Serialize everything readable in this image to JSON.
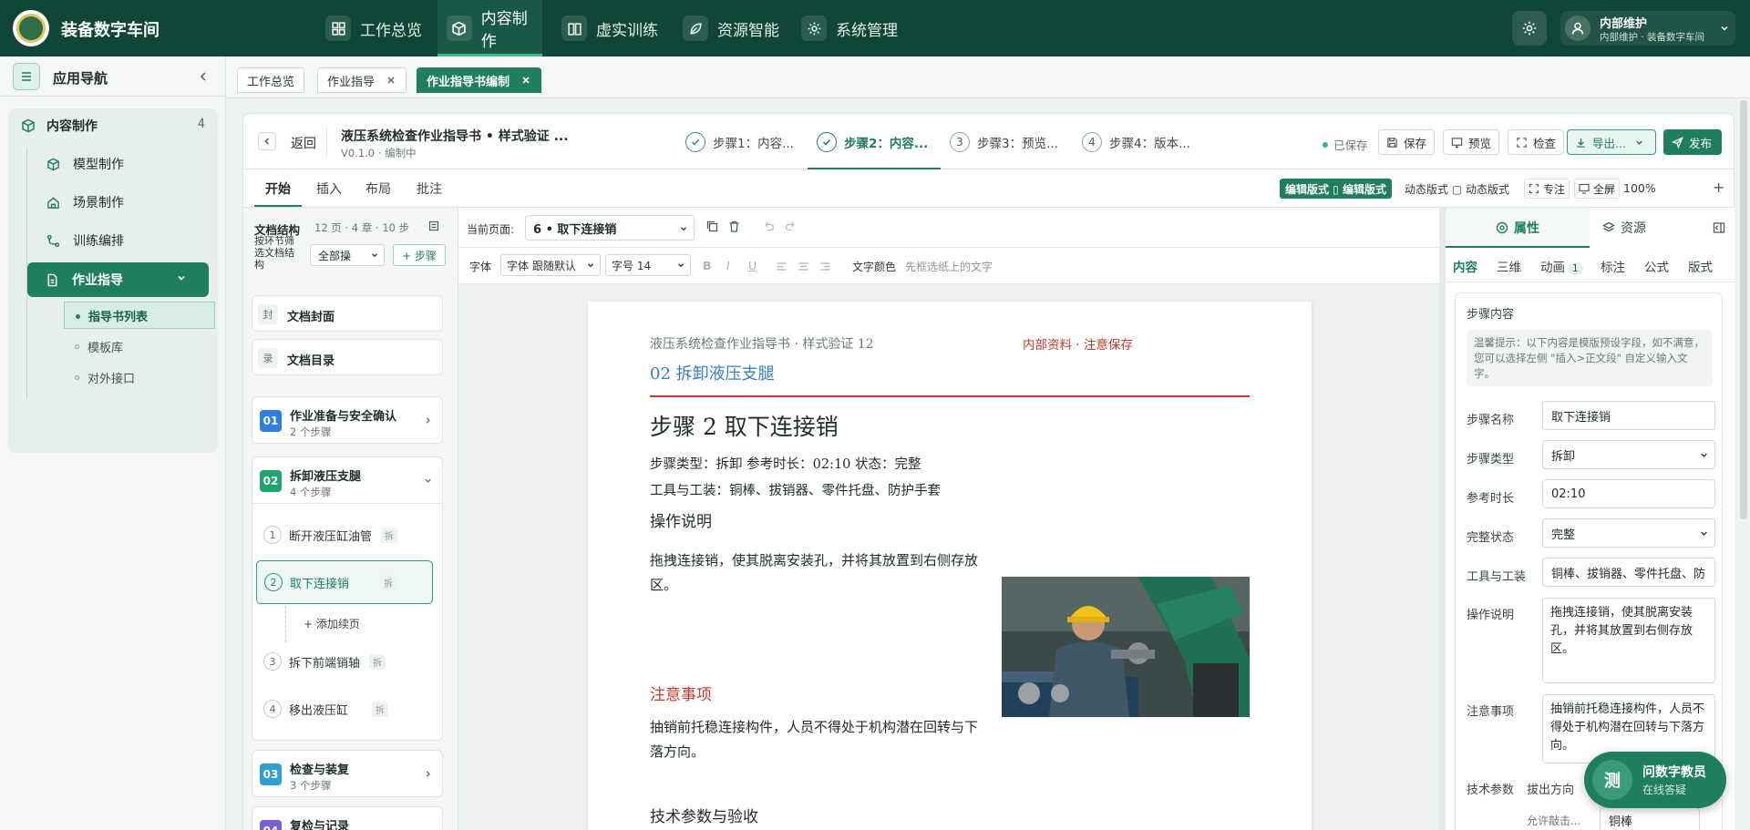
{
  "app": {
    "title": "装备数字车间"
  },
  "topnav": [
    {
      "label": "工作总览",
      "icon": "dashboard-icon",
      "active": false
    },
    {
      "label": "内容制作",
      "icon": "cube-icon",
      "active": true
    },
    {
      "label": "虚实训练",
      "icon": "book-icon",
      "active": false
    },
    {
      "label": "资源智能",
      "icon": "leaf-icon",
      "active": false
    },
    {
      "label": "系统管理",
      "icon": "gear-icon",
      "active": false
    }
  ],
  "user": {
    "name": "内部维护",
    "role": "内部维护 · 装备数字车间"
  },
  "sidebar": {
    "title": "应用导航",
    "group": {
      "label": "内容制作",
      "count": "4"
    },
    "items": [
      {
        "label": "模型制作",
        "icon": "cube-icon"
      },
      {
        "label": "场景制作",
        "icon": "home-icon"
      },
      {
        "label": "训练编排",
        "icon": "flow-icon"
      },
      {
        "label": "作业指导",
        "icon": "document-icon"
      }
    ],
    "subitems": [
      {
        "label": "指导书列表",
        "active": true
      },
      {
        "label": "模板库",
        "active": false
      },
      {
        "label": "对外接口",
        "active": false
      }
    ]
  },
  "tabs": [
    {
      "label": "工作总览",
      "closable": false,
      "active": false
    },
    {
      "label": "作业指导",
      "closable": true,
      "active": false
    },
    {
      "label": "作业指导书编制",
      "closable": true,
      "active": true
    }
  ],
  "editor": {
    "back_label": "返回",
    "doc_title": "液压系统检查作业指导书 • 样式验证 ...",
    "doc_version": "V0.1.0 · 编制中",
    "steps": [
      {
        "label": "步骤1：内容...",
        "state": "done",
        "num": "1"
      },
      {
        "label": "步骤2：内容...",
        "state": "active",
        "num": "2"
      },
      {
        "label": "步骤3：预览...",
        "state": "todo",
        "num": "3"
      },
      {
        "label": "步骤4：版本...",
        "state": "todo",
        "num": "4"
      }
    ],
    "saved_label": "已保存",
    "buttons": {
      "save": "保存",
      "preview": "预览",
      "check": "检查",
      "export": "导出...",
      "publish": "发布"
    }
  },
  "ribbon": {
    "tabs": [
      "开始",
      "插入",
      "布局",
      "批注"
    ],
    "mode_edit": "编辑版式 ▯ 编辑版式",
    "mode_dynamic": "动态版式 ▢ 动态版式",
    "focus": "专注",
    "fullscreen": "全屏",
    "zoom": "100%"
  },
  "structure": {
    "title": "文档结构",
    "meta": "12 页 · 4 章 · 10 步",
    "filter_label": "按环节筛选文档结构",
    "filter_value": "全部操",
    "add_step": "+ 步骤",
    "cover": {
      "tag": "封",
      "label": "文档封面"
    },
    "toc": {
      "tag": "录",
      "label": "文档目录"
    },
    "chapters": [
      {
        "num": "01",
        "title": "作业准备与安全确认",
        "sub": "2 个步骤",
        "color": "#2f7fe0"
      },
      {
        "num": "02",
        "title": "拆卸液压支腿",
        "sub": "4 个步骤",
        "color": "#1fa46f"
      },
      {
        "num": "03",
        "title": "检查与装复",
        "sub": "3 个步骤",
        "color": "#2f9fcf"
      },
      {
        "num": "04",
        "title": "复检与记录",
        "sub": "",
        "color": "#7a5fd0"
      }
    ],
    "chapter2_steps": [
      {
        "num": "1",
        "label": "断开液压缸油管",
        "badge": "拆"
      },
      {
        "num": "2",
        "label": "取下连接销",
        "badge": "拆"
      },
      {
        "num": "3",
        "label": "拆下前端销轴",
        "badge": "拆"
      },
      {
        "num": "4",
        "label": "移出液压缸",
        "badge": "拆"
      }
    ],
    "add_continuation": "+ 添加续页"
  },
  "page_toolbar": {
    "current_label": "当前页面:",
    "current_value": "6 • 取下连接销",
    "font_label": "字体",
    "font_value": "字体  跟随默认",
    "size_value": "字号  14",
    "bold": "B",
    "italic": "I",
    "underline": "U",
    "text_color": "文字颜色",
    "selection_hint": "先框选纸上的文字"
  },
  "document": {
    "header": "液压系统检查作业指导书  · 样式验证 12",
    "confidential": "内部资料  · 注意保存",
    "chapter": "02   拆卸液压支腿",
    "step_title": "步骤 2   取下连接销",
    "meta1": "步骤类型：拆卸   参考时长：02:10   状态：完整",
    "meta2": "工具与工装：铜棒、拔销器、零件托盘、防护手套",
    "op_heading": "操作说明",
    "op_text": "拖拽连接销，使其脱离安装孔，并将其放置到右侧存放区。",
    "note_heading": "注意事项",
    "note_text": "抽销前托稳连接构件，人员不得处于机构潜在回转与下落方向。",
    "tech_heading": "技术参数与验收"
  },
  "rightpanel": {
    "tabs": [
      {
        "label": "属性",
        "icon": "target-icon",
        "active": true
      },
      {
        "label": "资源",
        "icon": "layers-icon",
        "active": false
      }
    ],
    "subtabs": [
      {
        "label": "内容",
        "active": true
      },
      {
        "label": "三维",
        "active": false
      },
      {
        "label": "动画",
        "active": false,
        "badge": "1"
      },
      {
        "label": "标注",
        "active": false
      },
      {
        "label": "公式",
        "active": false
      },
      {
        "label": "版式",
        "active": false
      }
    ],
    "section_title": "步骤内容",
    "hint": "温馨提示：以下内容是模版预设字段，如不满意，您可以选择左侧 \"插入>正文段\" 自定义输入文字。",
    "fields": {
      "name_label": "步骤名称",
      "name_value": "取下连接销",
      "type_label": "步骤类型",
      "type_value": "拆卸",
      "duration_label": "参考时长",
      "duration_value": "02:10",
      "status_label": "完整状态",
      "status_value": "完整",
      "tools_label": "工具与工装",
      "tools_value": "铜棒、拔销器、零件托盘、防",
      "op_label": "操作说明",
      "op_value": "拖拽连接销，使其脱离安装孔，并将其放置到右侧存放区。",
      "note_label": "注意事项",
      "note_value": "抽销前托稳连接构件，人员不得处于机构潜在回转与下落方向。",
      "tech_label": "技术参数",
      "tech_value": "拔出方向",
      "allow_label": "允许敲击...",
      "allow_value": "铜棒"
    }
  },
  "assistant": {
    "avatar": "测",
    "title": "问数字教员",
    "subtitle": "在线答疑"
  }
}
